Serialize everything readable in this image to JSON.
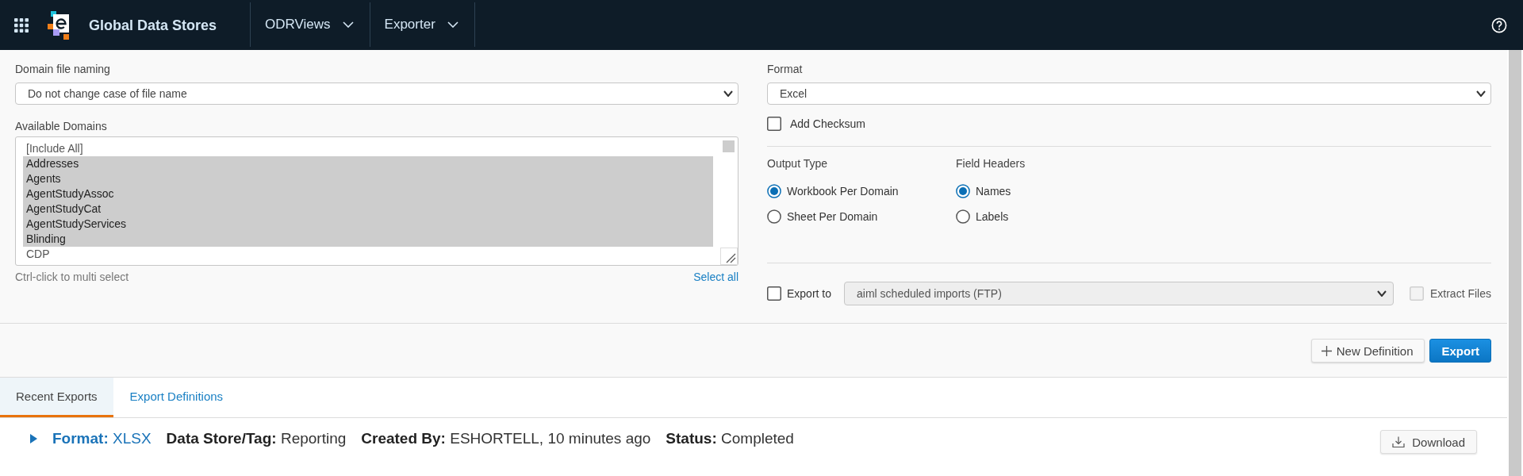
{
  "header": {
    "title": "Global Data Stores",
    "menus": [
      {
        "label": "ODRViews"
      },
      {
        "label": "Exporter"
      }
    ]
  },
  "domain_file_naming": {
    "label": "Domain file naming",
    "value": "Do not change case of file name"
  },
  "available_domains": {
    "label": "Available Domains",
    "items": [
      {
        "label": "[Include All]",
        "selected": false
      },
      {
        "label": "Addresses",
        "selected": true
      },
      {
        "label": "Agents",
        "selected": true
      },
      {
        "label": "AgentStudyAssoc",
        "selected": true
      },
      {
        "label": "AgentStudyCat",
        "selected": true
      },
      {
        "label": "AgentStudyServices",
        "selected": true
      },
      {
        "label": "Blinding",
        "selected": true
      },
      {
        "label": "CDP",
        "selected": false
      }
    ],
    "hint": "Ctrl-click to multi select",
    "select_all": "Select all"
  },
  "format": {
    "label": "Format",
    "value": "Excel"
  },
  "add_checksum": {
    "label": "Add Checksum",
    "checked": false
  },
  "output_type": {
    "label": "Output Type",
    "options": [
      {
        "label": "Workbook Per Domain",
        "selected": true
      },
      {
        "label": "Sheet Per Domain",
        "selected": false
      }
    ]
  },
  "field_headers": {
    "label": "Field Headers",
    "options": [
      {
        "label": "Names",
        "selected": true
      },
      {
        "label": "Labels",
        "selected": false
      }
    ]
  },
  "export_to": {
    "label": "Export to",
    "checked": false,
    "destination": {
      "value": "aiml scheduled imports (FTP)",
      "disabled": true
    }
  },
  "extract_files": {
    "label": "Extract Files",
    "checked": false,
    "disabled": true
  },
  "actions": [
    {
      "label": "New Definition",
      "kind": "secondary"
    },
    {
      "label": "Export",
      "kind": "primary"
    }
  ],
  "tabs": [
    {
      "label": "Recent Exports",
      "selected": true
    },
    {
      "label": "Export Definitions",
      "selected": false
    }
  ],
  "recent_exports": [
    {
      "expanded": false,
      "details": [
        {
          "text": "**Format:** XLSX",
          "kind": "link"
        },
        {
          "text": "**Data Store/Tag:** Reporting",
          "kind": "plain"
        },
        {
          "text": "**Created By:** ESHORTELL, 10 minutes ago",
          "kind": "plain"
        },
        {
          "text": "**Status:** Completed",
          "kind": "plain"
        }
      ],
      "action": "Download"
    }
  ]
}
